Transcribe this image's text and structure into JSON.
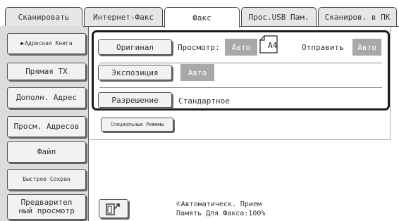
{
  "tabs": [
    {
      "label": "Сканировать"
    },
    {
      "label": "Интернет-Факс"
    },
    {
      "label": "Факс"
    },
    {
      "label": "Прос.USB Пам."
    },
    {
      "label": "Сканиров. в ПК"
    }
  ],
  "sidebar": {
    "items": [
      {
        "label": "Адресная Книга"
      },
      {
        "label": "Прямая TX"
      },
      {
        "label": "Дополн. Адрес"
      },
      {
        "label": "Просм. Адресов"
      },
      {
        "label": "Файл"
      },
      {
        "label": "Быстрое Сохран"
      },
      {
        "label_line1": "Предварител",
        "label_line2": "ный просмотр"
      }
    ]
  },
  "settings": {
    "original": {
      "button": "Оригинал",
      "preview_label": "Просмотр:",
      "preview_value": "Авто",
      "paper_size": "A4",
      "send_label": "Отправить",
      "send_value": "Авто"
    },
    "exposure": {
      "button": "Экспозиция",
      "value": "Авто"
    },
    "resolution": {
      "button": "Разрешение",
      "value": "Стандартное"
    }
  },
  "special_modes": {
    "label": "Специальные Режимы"
  },
  "status": {
    "receive": "Автоматическ. Прием",
    "memory": "Память Для Факса:100%"
  },
  "colors": {
    "value_box": "#a8a8a8",
    "frame": "#1a1a1a",
    "panel": "#dcdcdc"
  }
}
